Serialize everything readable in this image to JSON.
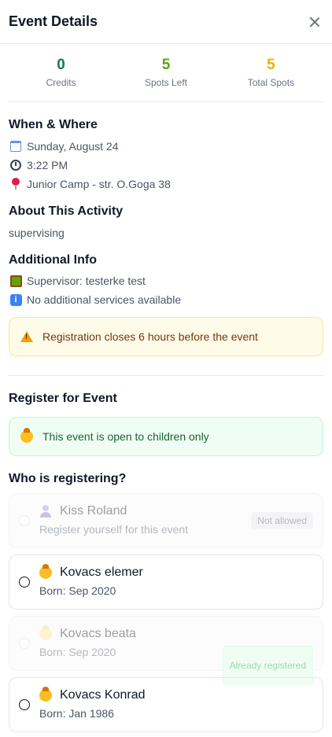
{
  "header": {
    "title": "Event Details"
  },
  "stats": [
    {
      "value": "0",
      "label": "Credits",
      "color": "#15803d"
    },
    {
      "value": "5",
      "label": "Spots Left",
      "color": "#65a30d"
    },
    {
      "value": "5",
      "label": "Total Spots",
      "color": "#eab308"
    }
  ],
  "when_where": {
    "heading": "When & Where",
    "date": "Sunday, August 24",
    "time": "3:22 PM",
    "location": "Junior Camp - str. O.Goga 38"
  },
  "about": {
    "heading": "About This Activity",
    "text": "supervising"
  },
  "additional": {
    "heading": "Additional Info",
    "supervisor": "Supervisor: testerke test",
    "services": "No additional services available"
  },
  "warning": {
    "text": "Registration closes 6 hours before the event"
  },
  "register": {
    "heading": "Register for Event",
    "notice": "This event is open to children only",
    "who_heading": "Who is registering?"
  },
  "registrants": [
    {
      "name": "Kiss Roland",
      "sub": "Register yourself for this event",
      "badge": "Not allowed"
    },
    {
      "name": "Kovacs elemer",
      "sub": "Born: Sep 2020"
    },
    {
      "name": "Kovacs beata",
      "sub": "Born: Sep 2020",
      "badge": "Already registered"
    },
    {
      "name": "Kovacs Konrad",
      "sub": "Born: Jan 1986"
    }
  ]
}
